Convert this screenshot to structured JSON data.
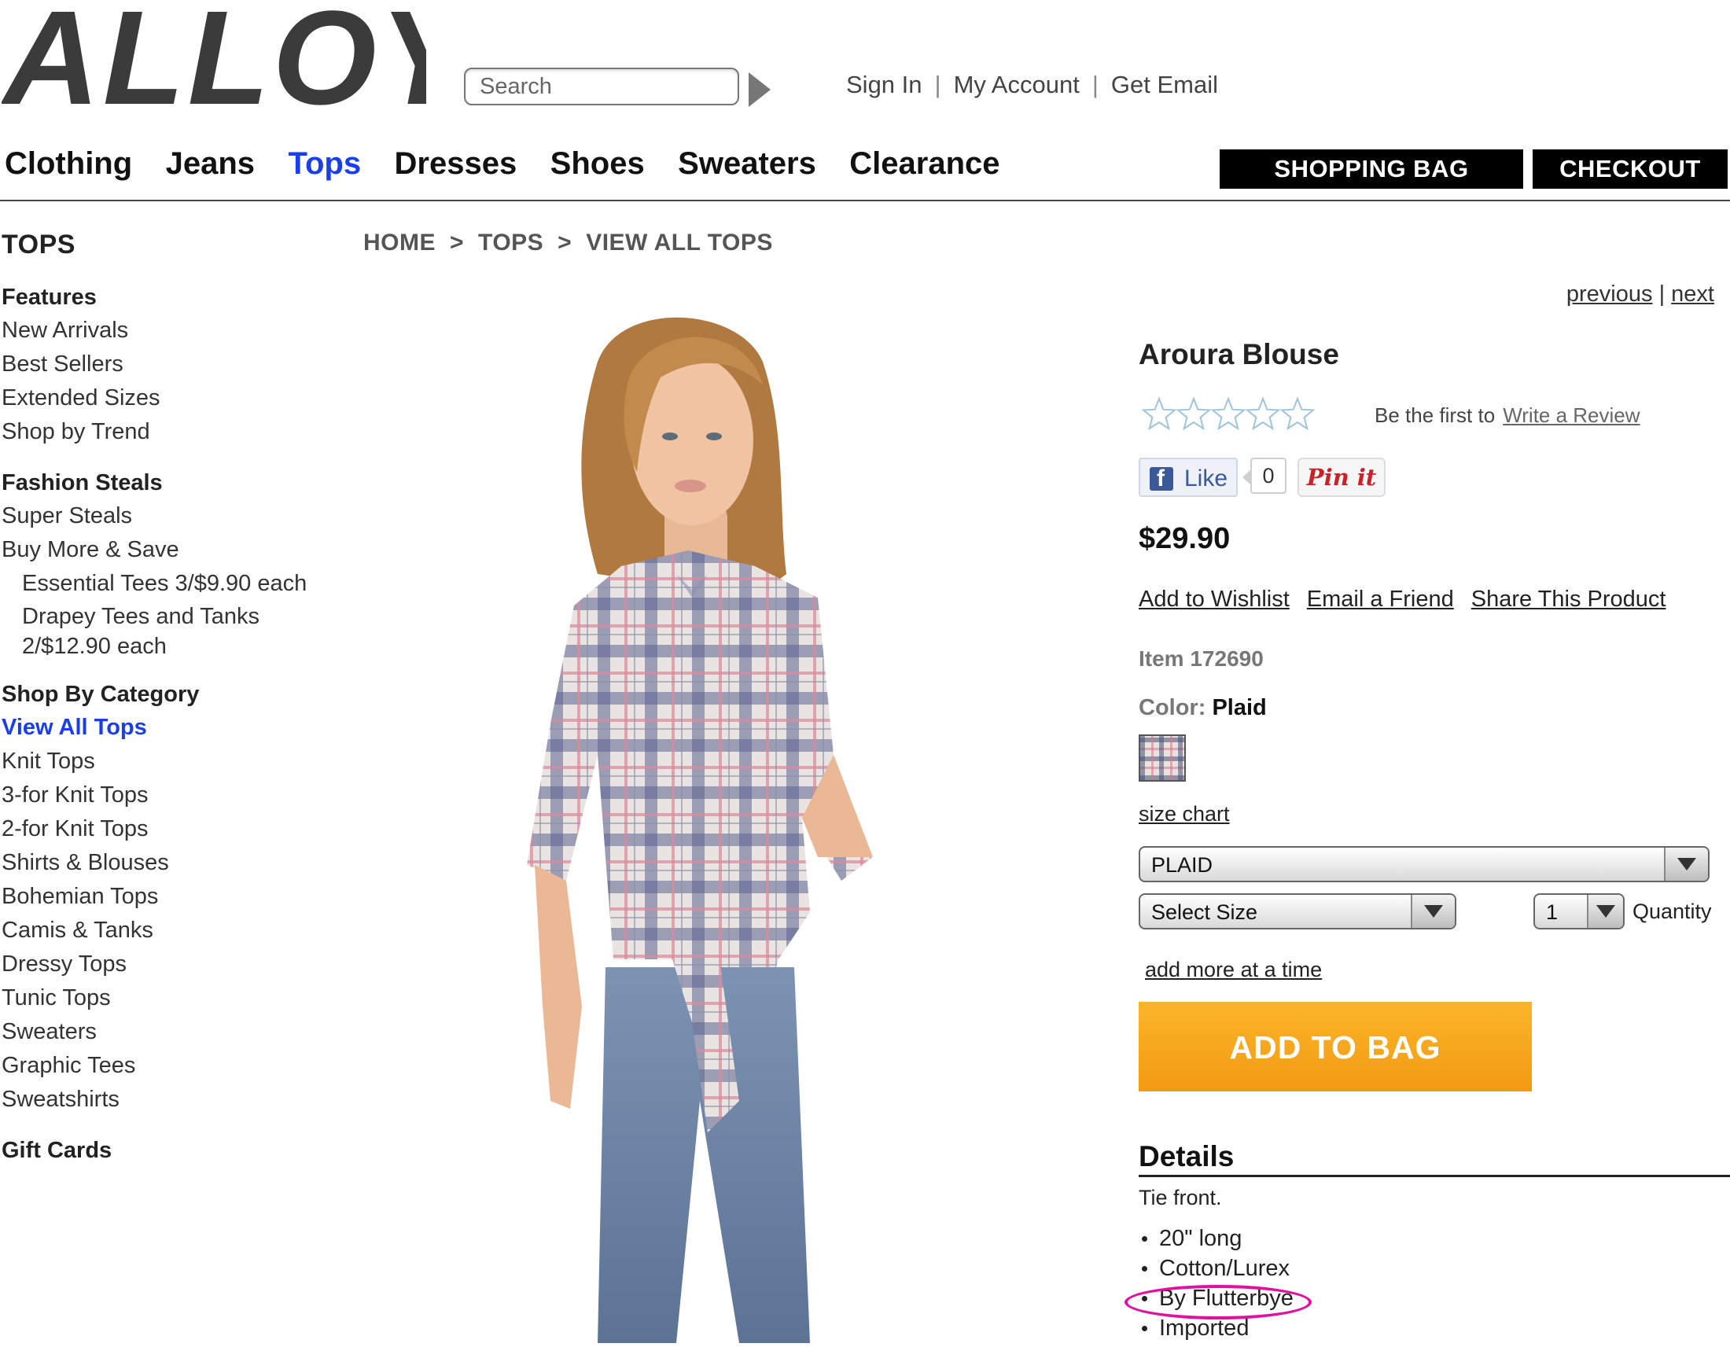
{
  "header": {
    "logo_text": "ALLOY",
    "search": {
      "placeholder": "Search"
    },
    "account_links": [
      "Sign In",
      "My Account",
      "Get Email"
    ],
    "shopping_bag_label": "SHOPPING BAG",
    "checkout_label": "CHECKOUT"
  },
  "nav": {
    "items": [
      "Clothing",
      "Jeans",
      "Tops",
      "Dresses",
      "Shoes",
      "Sweaters",
      "Clearance"
    ],
    "active": "Tops",
    "active_color": "#1a3ee8"
  },
  "sidebar": {
    "title": "TOPS",
    "features": {
      "title": "Features",
      "items": [
        "New Arrivals",
        "Best Sellers",
        "Extended Sizes",
        "Shop by Trend"
      ]
    },
    "fashion_steals": {
      "title": "Fashion Steals",
      "items": [
        "Super Steals",
        "Buy More & Save"
      ],
      "sub_items": [
        "Essential Tees 3/$9.90 each",
        "Drapey Tees and Tanks",
        "2/$12.90 each"
      ]
    },
    "shop_by_category": {
      "title": "Shop By Category",
      "items": [
        "View All Tops",
        "Knit Tops",
        "3-for Knit Tops",
        "2-for Knit Tops",
        "Shirts & Blouses",
        "Bohemian Tops",
        "Camis & Tanks",
        "Dressy Tops",
        "Tunic Tops",
        "Sweaters",
        "Graphic Tees",
        "Sweatshirts"
      ]
    },
    "gift_cards": "Gift Cards"
  },
  "breadcrumb": [
    "HOME",
    "TOPS",
    "VIEW ALL TOPS"
  ],
  "breadcrumb_separator": ">",
  "pagination": {
    "previous": "previous",
    "separator": "|",
    "next": "next"
  },
  "product": {
    "name": "Aroura Blouse",
    "rating_stars": 0,
    "rating_max": 5,
    "review_prompt": "Be the first to",
    "write_review": "Write a Review",
    "social": {
      "like_label": "Like",
      "like_count": "0",
      "pin_label": "Pin it"
    },
    "price": "$29.90",
    "actions": [
      "Add to Wishlist",
      "Email a Friend",
      "Share This Product"
    ],
    "item_number": "Item 172690",
    "color_label": "Color:",
    "color_value": "Plaid",
    "size_chart": "size chart",
    "color_select": "PLAID",
    "size_select": "Select Size",
    "quantity_value": "1",
    "quantity_label": "Quantity",
    "add_more": "add more at a time",
    "add_to_bag": "ADD TO BAG",
    "add_to_bag_color": "#f5a81c",
    "details": {
      "title": "Details",
      "intro": "Tie front.",
      "bullets": [
        "20\" long",
        "Cotton/Lurex",
        "By Flutterbye",
        "Imported"
      ],
      "highlighted_bullet": "By Flutterbye",
      "highlight_color": "#e0119f"
    }
  }
}
